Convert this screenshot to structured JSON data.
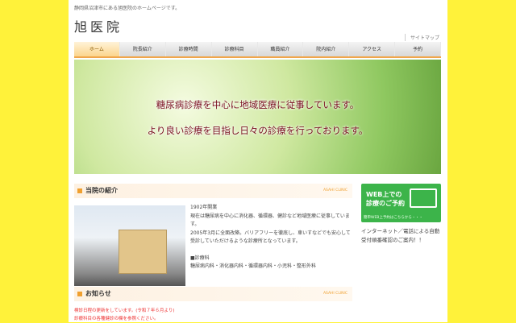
{
  "header": {
    "tagline": "静岡県沼津市にある旭医院のホームページです。",
    "logo_a": "旭",
    "logo_b": "医院",
    "sitemap": "サイトマップ"
  },
  "nav": [
    "ホーム",
    "院長紹介",
    "診療時間",
    "診療科目",
    "職員紹介",
    "院内紹介",
    "アクセス",
    "予約"
  ],
  "banner": {
    "line1": "糖尿病診療を中心に地域医療に従事しています。",
    "line2": "より良い診療を目指し日々の診療を行っております。"
  },
  "intro": {
    "title": "当院の紹介",
    "en": "ASAHI CLINIC",
    "lines": [
      "1902年開業",
      "現在は糖尿病を中心に消化器、循環器、健診など地域医療に従事しています。",
      "2005年3月に全面改築。バリアフリーを徹底し、車いすなどでも安心して受診していただけるような診療所となっています。",
      "",
      "■診療科",
      "糖尿病内科・消化器内科・循環器内科・小児科・整形外科"
    ]
  },
  "news": {
    "title": "お知らせ",
    "en": "ASAHI CLINIC",
    "items": [
      "検診日程の更新をしています。(令和７年６月より)",
      "診療科目の各種健診の欄を参照ください。"
    ]
  },
  "sidebar": {
    "web_title1": "WEB上での",
    "web_title2": "診療のご予約",
    "web_sub": "簡単WEB上予約はこちらから・・・",
    "text": "インターネット／電話による自動受付順番確認のご案内！！"
  }
}
